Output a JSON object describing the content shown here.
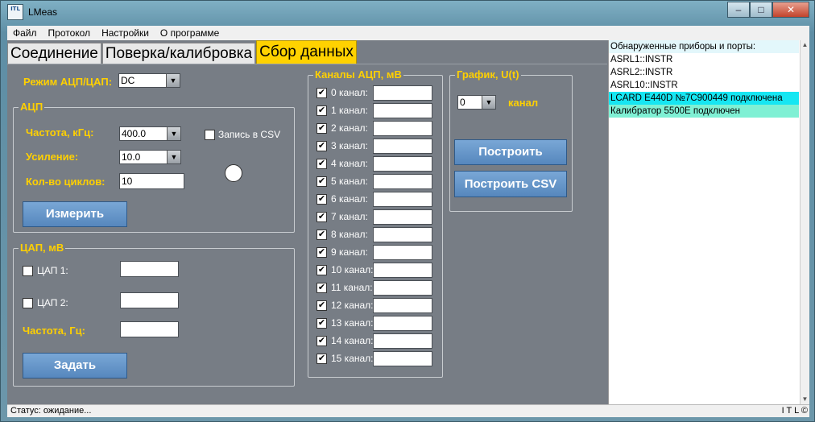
{
  "window": {
    "title": "LMeas",
    "icon_text": "ITL",
    "buttons": [
      "minimize",
      "maximize",
      "close"
    ]
  },
  "menu": [
    "Файл",
    "Протокол",
    "Настройки",
    "О программе"
  ],
  "tabs": [
    {
      "label": "Соединение",
      "active": false
    },
    {
      "label": "Поверка/калибровка",
      "active": false
    },
    {
      "label": "Сбор данных",
      "active": true
    }
  ],
  "mode": {
    "label": "Режим АЦП/ЦАП:",
    "value": "DC"
  },
  "adc": {
    "title": "АЦП",
    "freq_label": "Частота, кГц:",
    "freq_value": "400.0",
    "gain_label": "Усиление:",
    "gain_value": "10.0",
    "cycles_label": "Кол-во циклов:",
    "cycles_value": "10",
    "csv_label": "Запись в CSV",
    "csv_checked": false,
    "measure_button": "Измерить"
  },
  "dac": {
    "title": "ЦАП, мВ",
    "dac1_label": "ЦАП 1:",
    "dac1_checked": false,
    "dac1_value": "",
    "dac2_label": "ЦАП 2:",
    "dac2_checked": false,
    "dac2_value": "",
    "freq_label": "Частота, Гц:",
    "freq_value": "",
    "set_button": "Задать"
  },
  "channels": {
    "title": "Каналы АЦП, мВ",
    "items": [
      {
        "label": "0 канал:",
        "checked": true,
        "value": ""
      },
      {
        "label": "1 канал:",
        "checked": true,
        "value": ""
      },
      {
        "label": "2 канал:",
        "checked": true,
        "value": ""
      },
      {
        "label": "3 канал:",
        "checked": true,
        "value": ""
      },
      {
        "label": "4 канал:",
        "checked": true,
        "value": ""
      },
      {
        "label": "5 канал:",
        "checked": true,
        "value": ""
      },
      {
        "label": "6 канал:",
        "checked": true,
        "value": ""
      },
      {
        "label": "7 канал:",
        "checked": true,
        "value": ""
      },
      {
        "label": "8 канал:",
        "checked": true,
        "value": ""
      },
      {
        "label": "9 канал:",
        "checked": true,
        "value": ""
      },
      {
        "label": "10 канал:",
        "checked": true,
        "value": ""
      },
      {
        "label": "11 канал:",
        "checked": true,
        "value": ""
      },
      {
        "label": "12 канал:",
        "checked": true,
        "value": ""
      },
      {
        "label": "13 канал:",
        "checked": true,
        "value": ""
      },
      {
        "label": "14 канал:",
        "checked": true,
        "value": ""
      },
      {
        "label": "15 канал:",
        "checked": true,
        "value": ""
      }
    ]
  },
  "graph": {
    "title": "График, U(t)",
    "channel_value": "0",
    "channel_label": "канал",
    "build_button": "Построить",
    "build_csv_button": "Построить CSV"
  },
  "devices": [
    {
      "text": "Обнаруженные приборы и порты:",
      "color": "#e3f7fb"
    },
    {
      "text": "ASRL1::INSTR",
      "color": "#ffffff"
    },
    {
      "text": "ASRL2::INSTR",
      "color": "#ffffff"
    },
    {
      "text": "ASRL10::INSTR",
      "color": "#ffffff"
    },
    {
      "text": "LCARD E440D №7C900449 подключена",
      "color": "#16e6f2"
    },
    {
      "text": "Калибратор 5500E подключен",
      "color": "#7ff0d4"
    }
  ],
  "status": {
    "text": "Статус: ожидание...",
    "right": "I T L ©"
  },
  "colors": {
    "accent_yellow": "#ffd000",
    "active_tab": "#ffd200",
    "panel_bg": "#777d85",
    "button_blue": "#5f8fc4"
  }
}
